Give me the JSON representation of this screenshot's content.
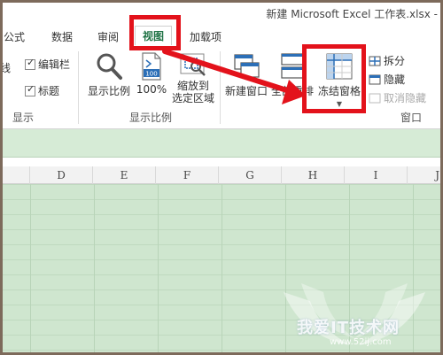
{
  "window": {
    "title": "新建 Microsoft Excel 工作表.xlsx -"
  },
  "tabs": [
    {
      "label": "公式"
    },
    {
      "label": "数据"
    },
    {
      "label": "审阅"
    },
    {
      "label": "视图",
      "active": true
    },
    {
      "label": "加载项"
    }
  ],
  "ribbon": {
    "show_group": {
      "label": "显示",
      "left_fragment": "线",
      "checkboxes": [
        {
          "label": "编辑栏",
          "checked": true
        },
        {
          "label": "标题",
          "checked": true
        }
      ]
    },
    "zoom_group": {
      "label": "显示比例",
      "commands": [
        {
          "label": "显示比例"
        },
        {
          "label": "100%",
          "icon_text": "100"
        },
        {
          "label_line1": "缩放到",
          "label_line2": "选定区域"
        }
      ]
    },
    "window_group": {
      "label": "窗口",
      "commands": [
        {
          "label": "新建窗口"
        },
        {
          "label": "全部重排"
        },
        {
          "label": "冻结窗格",
          "has_dropdown": true
        }
      ],
      "small_commands": [
        {
          "label": "拆分"
        },
        {
          "label": "隐藏"
        },
        {
          "label": "取消隐藏",
          "disabled": true
        }
      ]
    }
  },
  "sheet": {
    "columns": [
      "D",
      "E",
      "F",
      "G",
      "H",
      "I",
      "J"
    ]
  },
  "watermark": {
    "text": "我爱IT技术网",
    "url": "www.52ij.com"
  },
  "colors": {
    "accent": "#217346",
    "highlight": "#e3121b",
    "grid": "#cfe6cf"
  }
}
